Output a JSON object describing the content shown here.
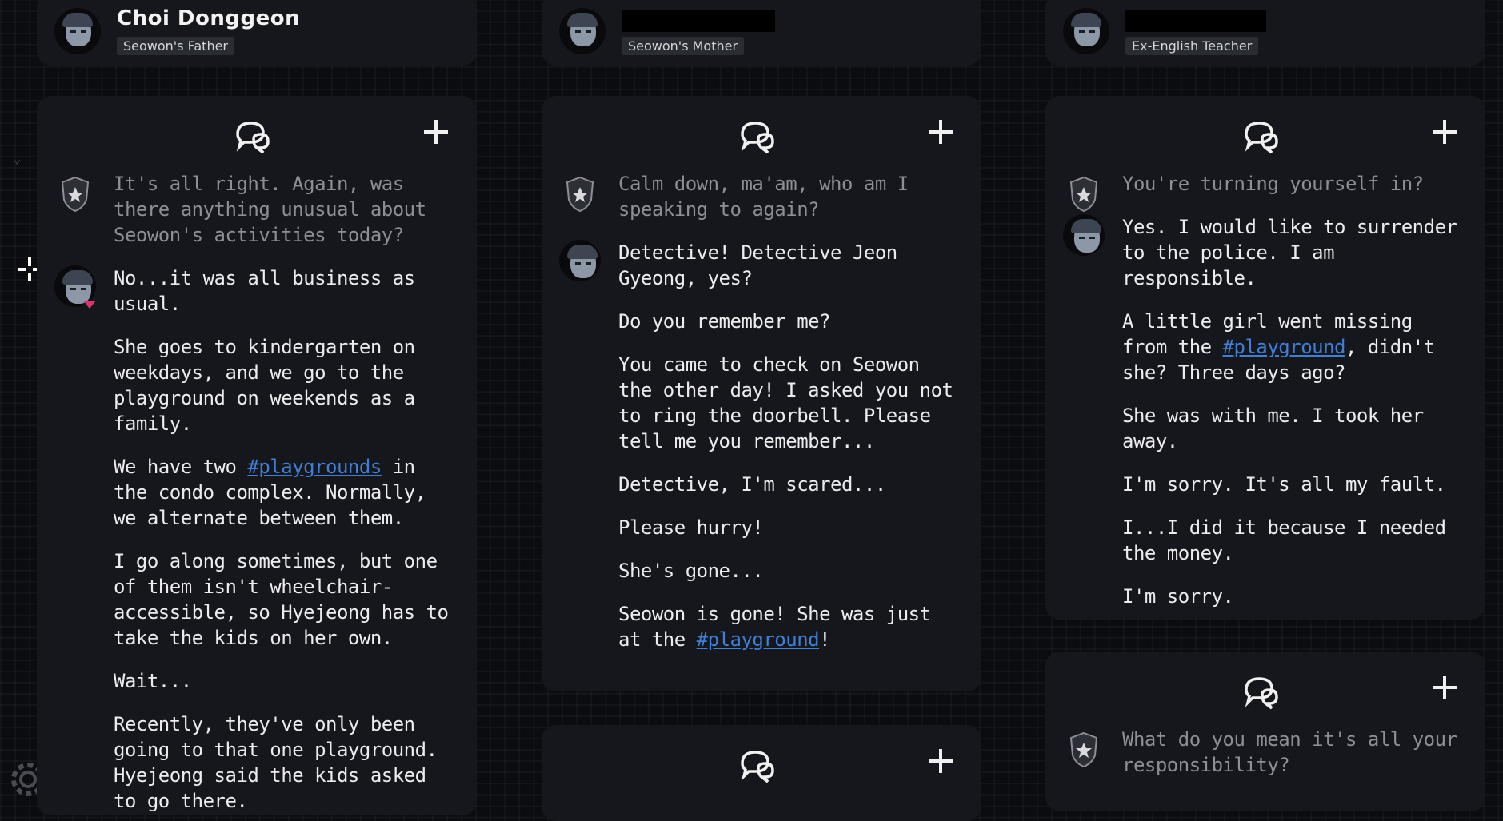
{
  "columns": [
    {
      "name": "Choi Donggeon",
      "role": "Seowon's Father",
      "cards": [
        {
          "messages": [
            {
              "speaker": "detective",
              "lines": [
                "It's all right. Again, was there anything unusual about Seowon's activities today?"
              ]
            },
            {
              "speaker": "character",
              "unread": true,
              "lines": [
                "No...it was all business as usual.",
                "She goes to kindergarten on weekdays, and we go to the playground on weekends as a family.",
                "We have two |#playgrounds| in the condo complex. Normally, we alternate between them.",
                "I go along sometimes, but one of them isn't wheelchair-accessible, so Hyejeong has to take the kids on her own.",
                "Wait...",
                "Recently, they've only been going to that one playground. Hyejeong said the kids asked to go there."
              ]
            }
          ]
        }
      ]
    },
    {
      "name": "",
      "role": "Seowon's Mother",
      "cards": [
        {
          "messages": [
            {
              "speaker": "detective",
              "lines": [
                "Calm down, ma'am, who am I speaking to again?"
              ]
            },
            {
              "speaker": "character",
              "lines": [
                "Detective! Detective Jeon Gyeong, yes?",
                "Do you remember me?",
                "You came to check on Seowon the other day! I asked you not to ring the doorbell. Please tell me you remember...",
                "Detective, I'm scared...",
                "Please hurry!",
                "She's gone...",
                "Seowon is gone! She was just at the |#playground|!"
              ]
            }
          ]
        },
        {
          "messages": []
        }
      ]
    },
    {
      "name": "",
      "role": "Ex-English Teacher",
      "cards": [
        {
          "messages": [
            {
              "speaker": "detective",
              "lines": [
                "You're turning yourself in?"
              ]
            },
            {
              "speaker": "character",
              "lines": [
                "Yes. I would like to surrender to the police. I am responsible.",
                "A little girl went missing from the |#playground|, didn't she? Three days ago?",
                "She was with me. I took her away.",
                "I'm sorry. It's all my fault.",
                "I...I did it because I needed the money.",
                "I'm sorry."
              ]
            }
          ]
        },
        {
          "messages": [
            {
              "speaker": "detective",
              "lines": [
                "What do you mean it's all your responsibility?"
              ]
            }
          ]
        }
      ]
    }
  ],
  "icons": {
    "chat": "chat-bubbles-icon",
    "add": "plus-icon",
    "detective": "police-badge-icon",
    "settings": "gear-icon",
    "cursor": "crosshair-cursor-icon",
    "collapse": "chevron-down-icon"
  },
  "colors": {
    "background": "#0b0c10",
    "card": "#16171c",
    "hashtag": "#3f7fd6",
    "detective_text": "#8d8f96",
    "unread": "#d8366b"
  }
}
